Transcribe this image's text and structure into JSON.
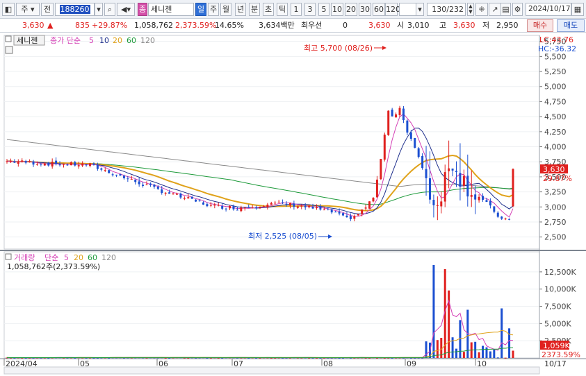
{
  "toolbar": {
    "mode_label": "주",
    "prefix_label": "전",
    "code_value": "188260",
    "stock_name": "세니젠",
    "stock_badge": "종",
    "periods": [
      "일",
      "주",
      "월",
      "년",
      "분",
      "초",
      "틱"
    ],
    "intervals": [
      "1",
      "3",
      "5",
      "10",
      "20",
      "30",
      "60",
      "120"
    ],
    "count_display": "130",
    "count_total": "/232",
    "date_value": "2024/10/17"
  },
  "quote": {
    "price": "3,630",
    "arrow": "▲",
    "change": "835",
    "change_pct": "+29.87%",
    "volume": "1,058,762",
    "volume_pct": "2,373.59%",
    "turnover": "14.65%",
    "amount": "3,634백만",
    "best_label": "최우선",
    "best_value": "0",
    "best_price": "3,630",
    "open_label": "시",
    "open_value": "3,010",
    "high_label": "고",
    "high_value": "3,630",
    "low_label": "저",
    "low_value": "2,950",
    "buy_label": "매수",
    "sell_label": "매도"
  },
  "price_panel": {
    "name_tag": "세니젠",
    "indicator_label": "종가 단순",
    "ma_periods": [
      "5",
      "10",
      "20",
      "60",
      "120"
    ],
    "lc_label": "LC:43.76",
    "hc_label": "HC:-36.32",
    "high_annotation": "최고 5,700 (08/26)",
    "low_annotation": "최저 2,525 (08/05)",
    "current_price_tag": "3,630",
    "current_pct_tag": "29.87%"
  },
  "volume_panel": {
    "indicator_label": "거래량",
    "ma_label": "단순",
    "ma_periods": [
      "5",
      "20",
      "60",
      "120"
    ],
    "volume_readout": "1,058,762주(2,373.59%)",
    "current_volume_tag": "1,059K",
    "current_pct_tag": "2373.59%"
  },
  "x_axis": {
    "month_labels": [
      "2024/04",
      "05",
      "06",
      "07",
      "08",
      "09",
      "10"
    ],
    "end_label": "10/17"
  },
  "colors": {
    "up": "#e0201e",
    "down": "#1b4fd1",
    "ma5": "#d43fb5",
    "ma10": "#1e2f8c",
    "ma20": "#e0a21a",
    "ma60": "#1d9a3a",
    "ma120": "#8a8a8a"
  },
  "chart_data": {
    "type": "candlestick",
    "price_axis_ticks": [
      2500,
      2750,
      3000,
      3250,
      3500,
      3750,
      4000,
      4250,
      4500,
      4750,
      5000,
      5250,
      5500,
      5750
    ],
    "price_ylim": [
      2300,
      5850
    ],
    "volume_axis_ticks": [
      "2,500K",
      "5,000K",
      "7,500K",
      "10,000K",
      "12,500K"
    ],
    "volume_tick_values": [
      2500,
      5000,
      7500,
      10000,
      12500
    ],
    "volume_ylim": [
      0,
      14000
    ],
    "key_points": [
      {
        "label": "highest",
        "date": "08/26",
        "value": 5700
      },
      {
        "label": "lowest",
        "date": "08/05",
        "value": 2525
      },
      {
        "label": "last close",
        "date": "10/17",
        "value": 3630
      }
    ],
    "last_candle": {
      "open": 3010,
      "high": 3630,
      "low": 2950,
      "close": 3630
    },
    "last_volume_k": 1059
  }
}
